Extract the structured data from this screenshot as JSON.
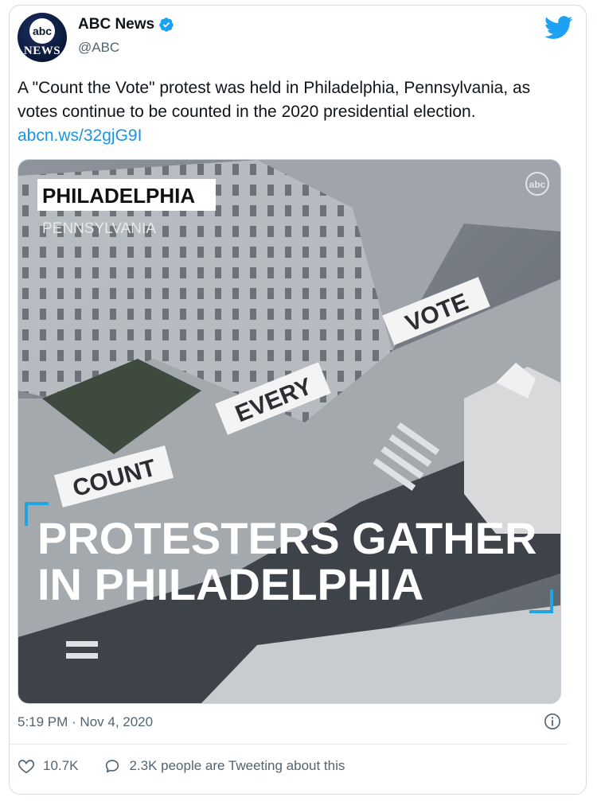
{
  "account": {
    "avatar_top": "abc",
    "avatar_bottom": "NEWS",
    "display_name": "ABC News",
    "handle": "@ABC",
    "verified_icon": "verified-badge-icon"
  },
  "tweet": {
    "text": "A \"Count the Vote\" protest was held in Philadelphia, Pennsylvania, as votes continue to be counted in the 2020 presidential election. ",
    "link": "abcn.ws/32gjG9I",
    "timestamp": "5:19 PM · Nov 4, 2020"
  },
  "media": {
    "city": "PHILADELPHIA",
    "state": "PENNSYLVANIA",
    "sign_count": "COUNT",
    "sign_every": "EVERY",
    "sign_vote": "VOTE",
    "headline_line1": "PROTESTERS GATHER",
    "headline_line2": "IN PHILADELPHIA",
    "watermark": "abc NEWS"
  },
  "actions": {
    "likes": "10.7K",
    "replies": "2.3K people are Tweeting about this"
  },
  "colors": {
    "link": "#1b95e0",
    "twitter_blue": "#1da1f2",
    "text_secondary": "#536471"
  }
}
